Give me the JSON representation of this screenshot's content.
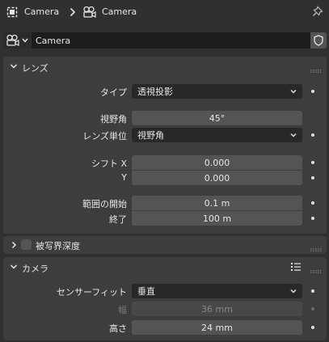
{
  "header": {
    "object_name": "Camera",
    "data_name": "Camera",
    "icons": {
      "object": "object-data-icon",
      "separator": "chevron-right-icon",
      "data": "camera-data-icon",
      "pin": "pin-icon"
    }
  },
  "datablock": {
    "name": "Camera",
    "selector_icon": "camera-data-icon",
    "fake_user_icon": "shield-icon"
  },
  "lens_panel": {
    "title": "レンズ",
    "type_label": "タイプ",
    "type_value": "透視投影",
    "fov_label": "視野角",
    "fov_value": "45°",
    "lens_unit_label": "レンズ単位",
    "lens_unit_value": "視野角",
    "shift_x_label": "シフト X",
    "shift_x_value": "0.000",
    "shift_y_label": "Y",
    "shift_y_value": "0.000",
    "clip_start_label": "範囲の開始",
    "clip_start_value": "0.1 m",
    "clip_end_label": "終了",
    "clip_end_value": "100 m"
  },
  "dof_panel": {
    "title": "被写界深度",
    "enabled": false
  },
  "camera_panel": {
    "title": "カメラ",
    "preset_icon": "preset-list-icon",
    "sensor_fit_label": "センサーフィット",
    "sensor_fit_value": "垂直",
    "width_label": "幅",
    "width_value": "36 mm",
    "height_label": "高さ",
    "height_value": "24 mm"
  },
  "colors": {
    "background": "#303030",
    "panel": "#3d3d3d",
    "field": "#545454",
    "dropdown": "#282828",
    "text": "#e6e6e6",
    "disabled_text": "#878787"
  }
}
